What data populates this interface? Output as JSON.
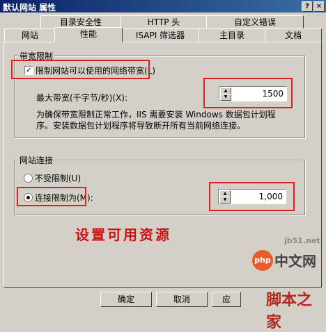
{
  "window": {
    "title": "默认网站 属性",
    "help_btn": "?",
    "close_btn": "✕"
  },
  "tabs_row1": [
    "目录安全性",
    "HTTP 头",
    "自定义错误"
  ],
  "tabs_row2": [
    "网站",
    "性能",
    "ISAPI 筛选器",
    "主目录",
    "文档"
  ],
  "bandwidth": {
    "legend": "带宽限制",
    "checkbox_label": "限制网站可以使用的网络带宽(L)",
    "max_label": "最大带宽(千字节/秒)(X):",
    "max_value": "1500",
    "desc_line1": "为确保带宽限制正常工作，IIS 需要安装 Windows 数据包计划程",
    "desc_line2": "序。安装数据包计划程序将导致断开所有当前网络连接。"
  },
  "connections": {
    "legend": "网站连接",
    "unlimited_label": "不受限制(U)",
    "limit_label": "连接限制为(M):",
    "limit_value": "1,000"
  },
  "annotation": "设置可用资源",
  "buttons": {
    "ok": "确定",
    "cancel": "取消",
    "apply": "应"
  },
  "watermarks": {
    "site": "jb51.net",
    "php": "php",
    "php_cn": "中文网",
    "brand": "脚本之家"
  },
  "colors": {
    "highlight": "#e02020",
    "annotation": "#cc1111"
  }
}
